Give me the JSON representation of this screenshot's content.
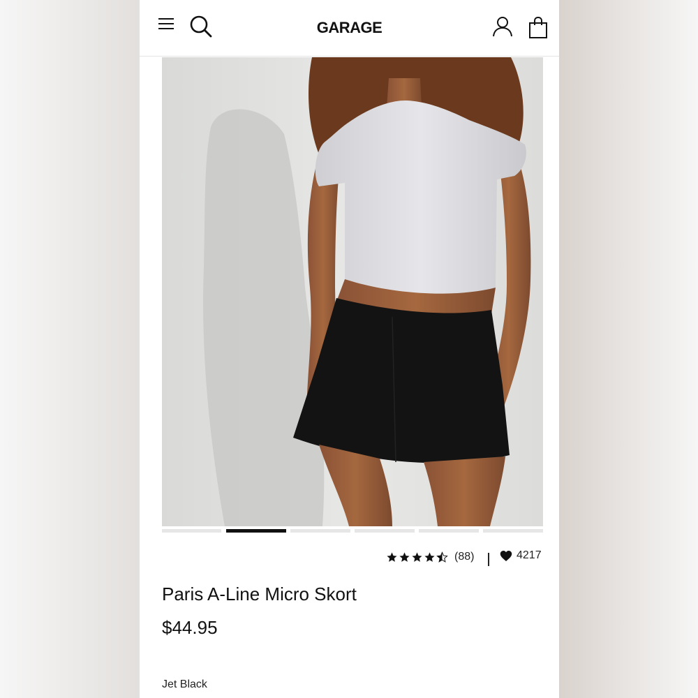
{
  "header": {
    "logo": "GARAGE",
    "icons": [
      "menu-icon",
      "search-icon",
      "account-icon",
      "shopping-bag-icon"
    ]
  },
  "gallery": {
    "image_subject": "model-wearing-black-skort",
    "slide_count": 6,
    "active_slide": 2
  },
  "rating": {
    "stars": 4.5,
    "max_stars": 5,
    "review_count": "(88)",
    "favorites_count": "4217"
  },
  "product": {
    "title": "Paris A-Line Micro Skort",
    "price": "$44.95",
    "color": "Jet Black"
  },
  "colors": {
    "text": "#111111",
    "active_indicator": "#111111",
    "inactive_indicator": "#e6e6e6"
  }
}
